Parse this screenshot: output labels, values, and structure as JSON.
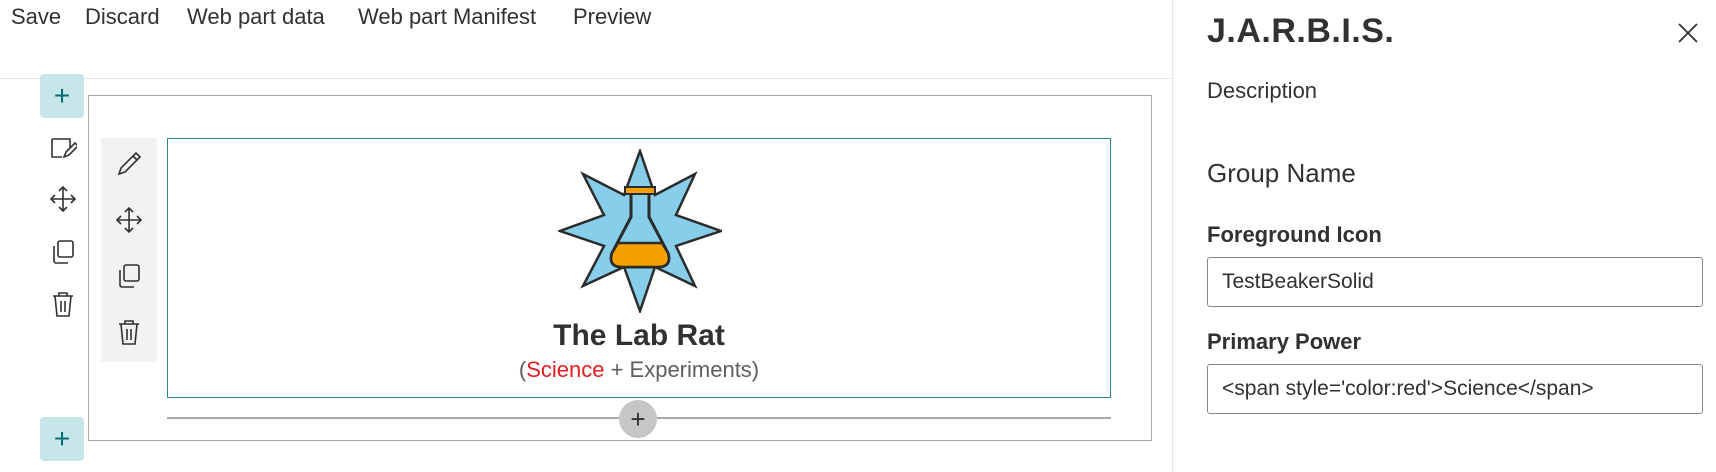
{
  "toolbar": {
    "save": "Save",
    "discard": "Discard",
    "web_part_data": "Web part data",
    "web_part_manifest": "Web part Manifest",
    "preview": "Preview"
  },
  "canvas": {
    "add_symbol": "+",
    "webpart": {
      "icon": "beaker-in-star-icon",
      "title": "The Lab Rat",
      "subtitle": {
        "open": "(",
        "power": "Science",
        "rest": " + Experiments)"
      },
      "power_color": "#e02020"
    }
  },
  "panel": {
    "title": "J.A.R.B.I.S.",
    "description_label": "Description",
    "group_name_label": "Group Name",
    "foreground_icon_label": "Foreground Icon",
    "foreground_icon_value": "TestBeakerSolid",
    "primary_power_label": "Primary Power",
    "primary_power_value": "<span style='color:red'>Science</span>"
  },
  "colors": {
    "accent": "#036c70",
    "add_button_bg": "#c7e6ea",
    "webpart_border": "#2a8a8f",
    "star_fill": "#87ceeb",
    "beaker_fill": "#f5a000"
  }
}
